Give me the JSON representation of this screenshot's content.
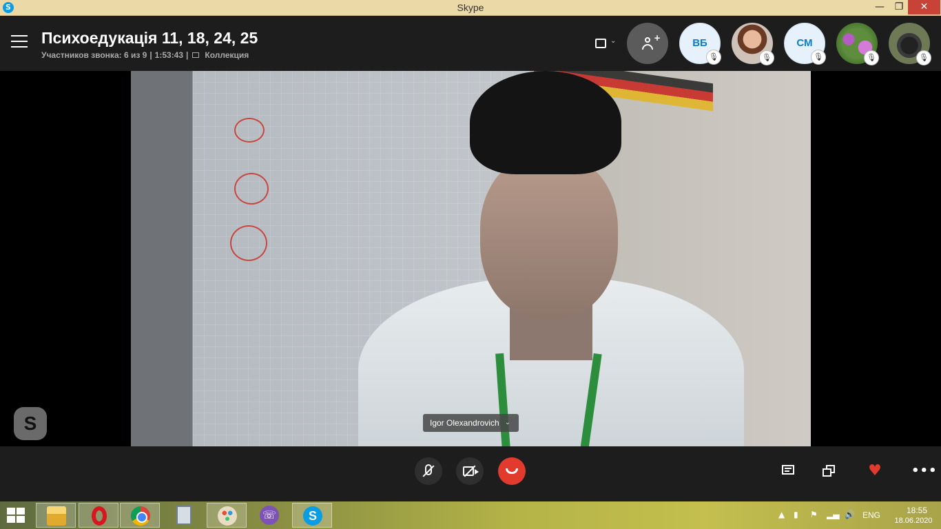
{
  "window": {
    "title": "Skype",
    "app_icon_glyph": "S",
    "minimize_glyph": "—",
    "maximize_glyph": "❐",
    "close_glyph": "✕"
  },
  "header": {
    "call_title": "Психоедукація 11, 18, 24, 25",
    "participants_label": "Участников звонка: 6 из 9",
    "duration": "1:53:43",
    "collection_label": "Коллекция",
    "separator": "|"
  },
  "participants": [
    {
      "initials": "ВБ",
      "muted": true,
      "icon": "mute-icon"
    },
    {
      "initials": "",
      "muted": true,
      "icon": "mute-icon",
      "photo": "woman-portrait"
    },
    {
      "initials": "СМ",
      "muted": true,
      "icon": "mute-icon"
    },
    {
      "initials": "",
      "muted": true,
      "icon": "mute-icon",
      "photo": "flowers"
    },
    {
      "initials": "",
      "muted": true,
      "icon": "mute-icon",
      "photo": "dog"
    }
  ],
  "mute_badge_glyph": "🎙",
  "video": {
    "speaker_name": "Igor Olexandrovich",
    "name_chevron": "⌄",
    "skype_badge_glyph": "S"
  },
  "controls": {
    "chat_icon": "chat-icon",
    "layout_icon": "switch-layout-icon",
    "react_glyph": "♥",
    "more_glyph": "•••",
    "hangup_color": "#e23b2e"
  },
  "taskbar": {
    "apps": [
      "file-explorer",
      "opera",
      "chrome",
      "calculator",
      "paint",
      "viber",
      "skype"
    ],
    "viber_glyph": "☏",
    "skype_glyph": "S",
    "language": "ENG",
    "time": "18:55",
    "date": "18.06.2020"
  },
  "colors": {
    "titlebar": "#ecd9a8",
    "header_bg": "#1d1d1d",
    "accent": "#0a9de3",
    "hangup": "#e23b2e"
  }
}
